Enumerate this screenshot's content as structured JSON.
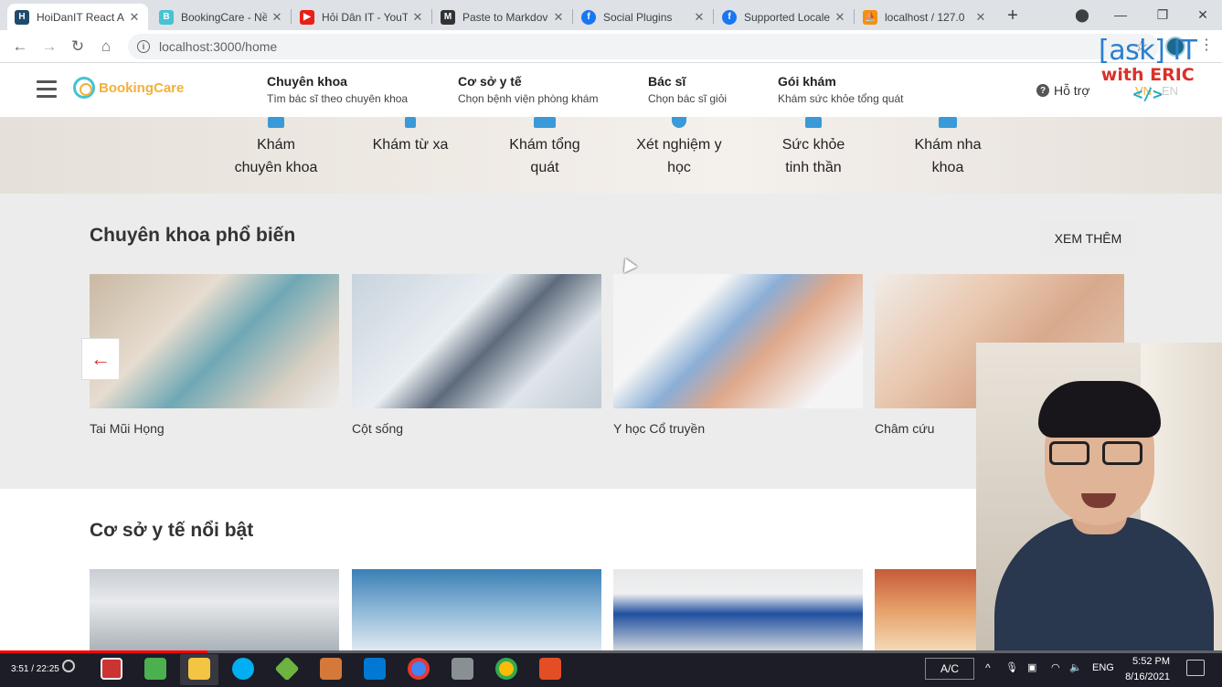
{
  "browser": {
    "tabs": [
      {
        "title": "HoiDanIT React A",
        "color": "#1f4a6e",
        "icon": "H"
      },
      {
        "title": "BookingCare - Nề",
        "color": "#45c3d2",
        "icon": "B"
      },
      {
        "title": "Hỏi Dân IT - YouT",
        "color": "#e62117",
        "icon": "▶"
      },
      {
        "title": "Paste to Markdov",
        "color": "#333333",
        "icon": "M"
      },
      {
        "title": "Social Plugins",
        "color": "#1877f2",
        "icon": "f"
      },
      {
        "title": "Supported Locale",
        "color": "#1877f2",
        "icon": "f"
      },
      {
        "title": "localhost / 127.0",
        "color": "#f29111",
        "icon": "⛵"
      }
    ],
    "url": "localhost:3000/home"
  },
  "header": {
    "logo_text": "BookingCare",
    "menu": [
      {
        "title": "Chuyên khoa",
        "sub": "Tìm bác sĩ theo chuyên khoa"
      },
      {
        "title": "Cơ sở y tế",
        "sub": "Chọn bệnh viện phòng khám"
      },
      {
        "title": "Bác sĩ",
        "sub": "Chọn bác sĩ giỏi"
      },
      {
        "title": "Gói khám",
        "sub": "Khám sức khỏe tổng quát"
      }
    ],
    "support": "Hỗ trợ",
    "lang_vn": "VN",
    "lang_en": "EN"
  },
  "services": [
    {
      "line1": "Khám",
      "line2": "chuyên khoa"
    },
    {
      "line1": "Khám từ xa",
      "line2": ""
    },
    {
      "line1": "Khám tổng",
      "line2": "quát"
    },
    {
      "line1": "Xét nghiệm y",
      "line2": "học"
    },
    {
      "line1": "Sức khỏe",
      "line2": "tinh thần"
    },
    {
      "line1": "Khám nha",
      "line2": "khoa"
    }
  ],
  "watermark": {
    "line1": "[ask] IT",
    "line2": "with ERIC",
    "line3": "</>"
  },
  "specialty": {
    "title": "Chuyên khoa phổ biến",
    "more": "XEM THÊM",
    "items": [
      "Tai Mũi Họng",
      "Cột sống",
      "Y học Cổ truyền",
      "Châm cứu"
    ],
    "prev": "←"
  },
  "facility": {
    "title": "Cơ sở y tế nổi bật"
  },
  "taskbar": {
    "video_time": "3:51 / 22:25",
    "video_progress": 0.17,
    "ac_label": "A/C",
    "lang": "ENG",
    "time": "5:52 PM",
    "date": "8/16/2021"
  }
}
